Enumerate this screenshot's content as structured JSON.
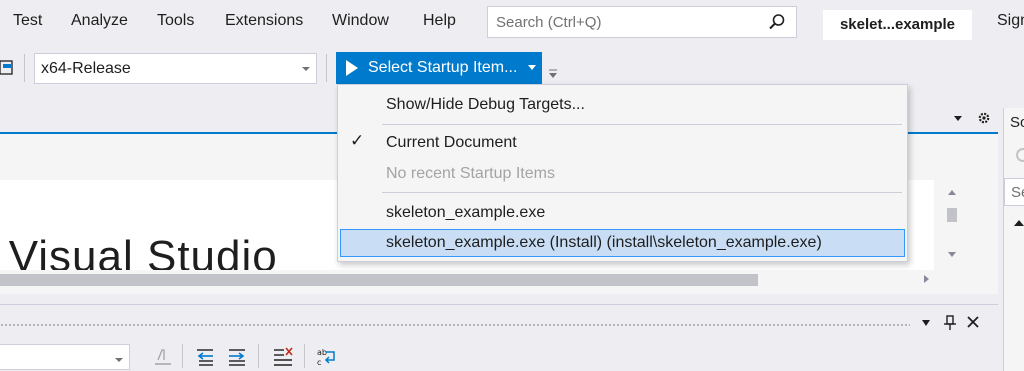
{
  "menubar": {
    "items": [
      "Test",
      "Analyze",
      "Tools",
      "Extensions",
      "Window",
      "Help"
    ],
    "search_placeholder": "Search (Ctrl+Q)",
    "solution_title": "skelet...example",
    "signin": "Sign"
  },
  "toolbar": {
    "configuration": "x64-Release",
    "startup_button": "Select Startup Item..."
  },
  "startup_menu": {
    "show_hide": "Show/Hide Debug Targets...",
    "current_document": "Current Document",
    "no_recent": "No recent Startup Items",
    "item_exe": "skeleton_example.exe",
    "item_install": "skeleton_example.exe (Install) (install\\skeleton_example.exe)",
    "check_glyph": "✓"
  },
  "editor": {
    "visible_title": "n Visual Studio"
  },
  "solution_explorer": {
    "title": "So",
    "search_placeholder": "Se"
  },
  "colors": {
    "accent": "#007acc",
    "menu_selected_bg": "#c9def5",
    "menu_selected_border": "#3399ff"
  },
  "icons": [
    "search-icon",
    "play-icon",
    "chevron-down-icon",
    "toolbar-overflow-icon",
    "gear-icon",
    "pin-icon",
    "close-icon",
    "checkmark-icon"
  ]
}
